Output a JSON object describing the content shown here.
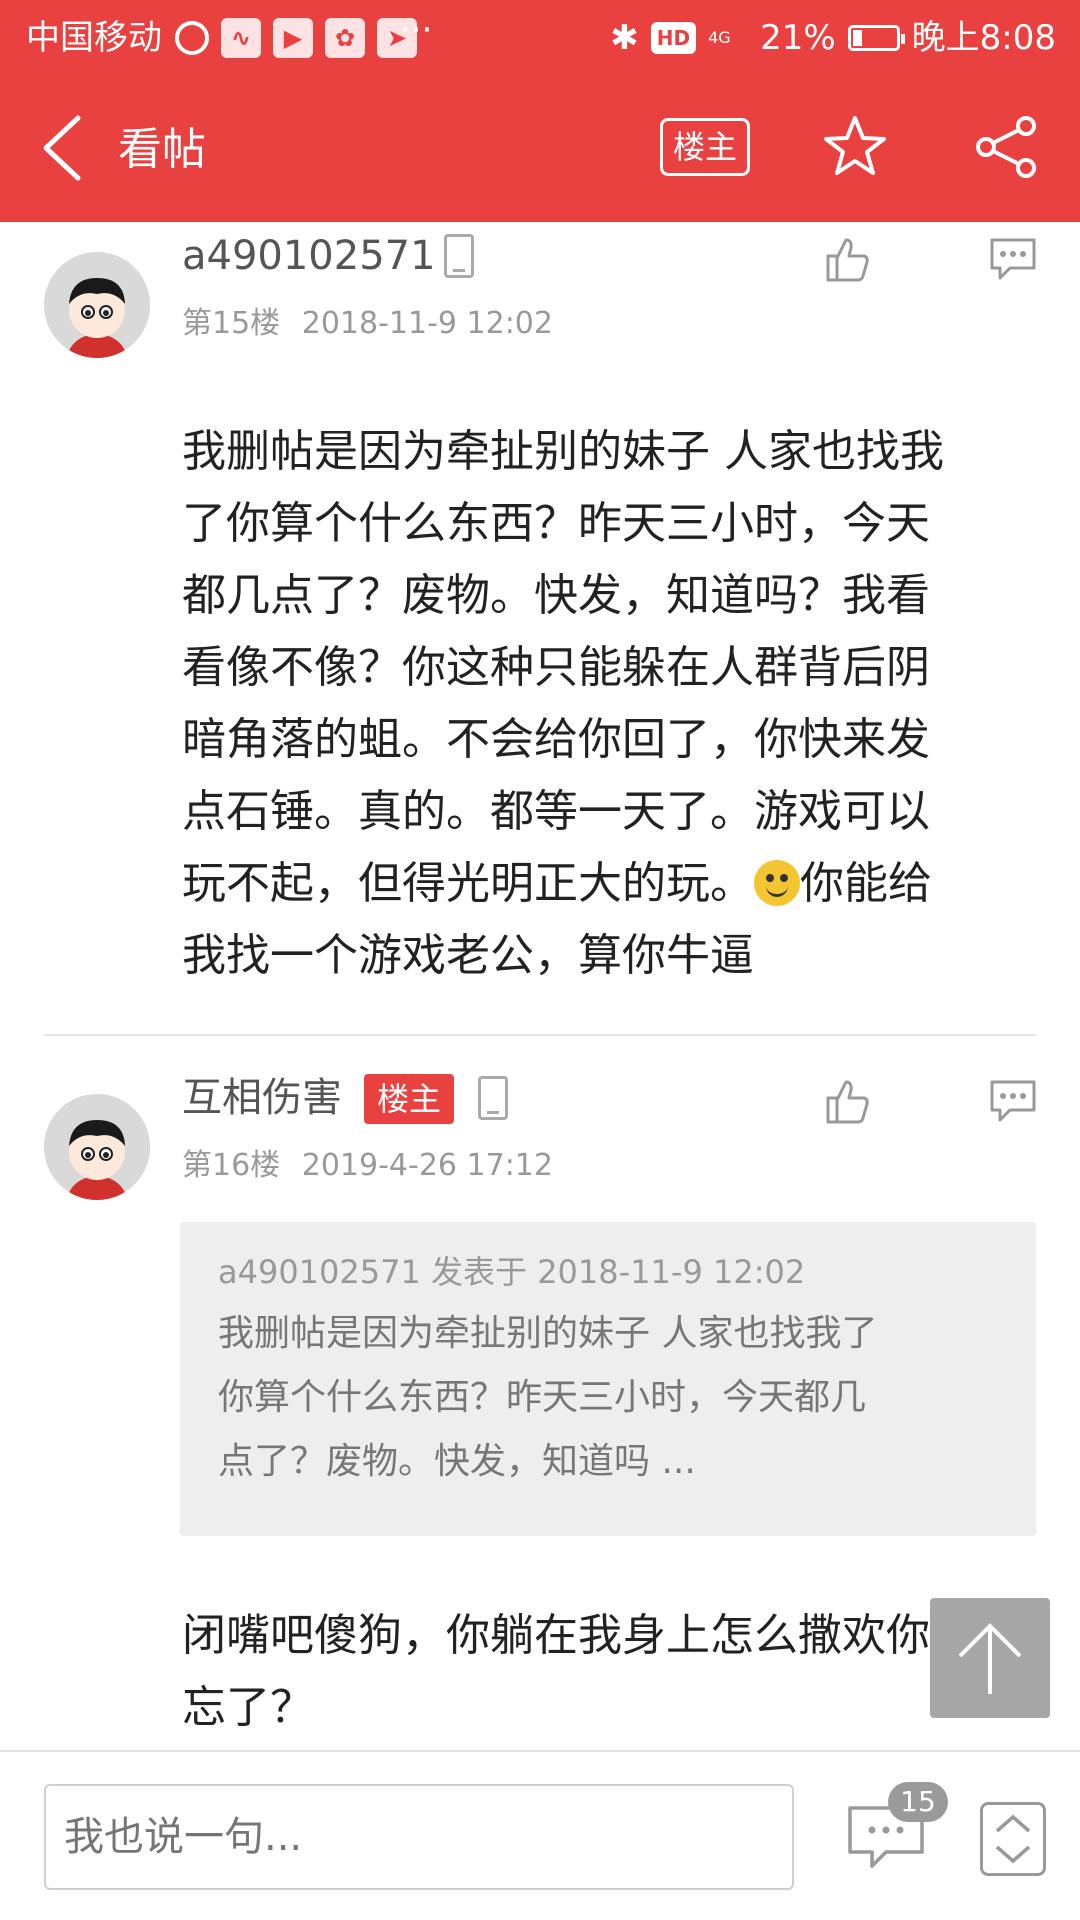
{
  "status_bar": {
    "carrier": "中国移动",
    "more": "···",
    "hd": "HD",
    "network": "4G",
    "battery": "21%",
    "battery_level": 0.21,
    "time": "晚上8:08"
  },
  "header": {
    "title": "看帖",
    "owner_button": "楼主"
  },
  "posts": [
    {
      "username": "a490102571",
      "floor": "第15楼",
      "timestamp": "2018-11-9 12:02",
      "lines": [
        "我删帖是因为牵扯别的妹子 人家也找我",
        "了你算个什么东西？昨天三小时，今天",
        "都几点了？废物。快发，知道吗？我看",
        "看像不像？你这种只能躲在人群背后阴",
        "暗角落的蛆。不会给你回了，你快来发",
        "点石锤。真的。都等一天了。游戏可以",
        "玩不起，但得光明正大的玩。",
        "你能给",
        "我找一个游戏老公，算你牛逼"
      ]
    },
    {
      "username": "互相伤害",
      "badge": "楼主",
      "floor": "第16楼",
      "timestamp": "2019-4-26 17:12",
      "quote": {
        "meta": "a490102571 发表于 2018-11-9 12:02",
        "lines": [
          "我删帖是因为牵扯别的妹子 人家也找我了",
          "你算个什么东西？昨天三小时，今天都几",
          "点了？废物。快发，知道吗 ..."
        ]
      },
      "lines": [
        "闭嘴吧傻狗，你躺在我身上怎么撒欢你",
        "忘了？"
      ]
    }
  ],
  "bottom_bar": {
    "reply_placeholder": "我也说一句...",
    "comment_count": "15"
  }
}
